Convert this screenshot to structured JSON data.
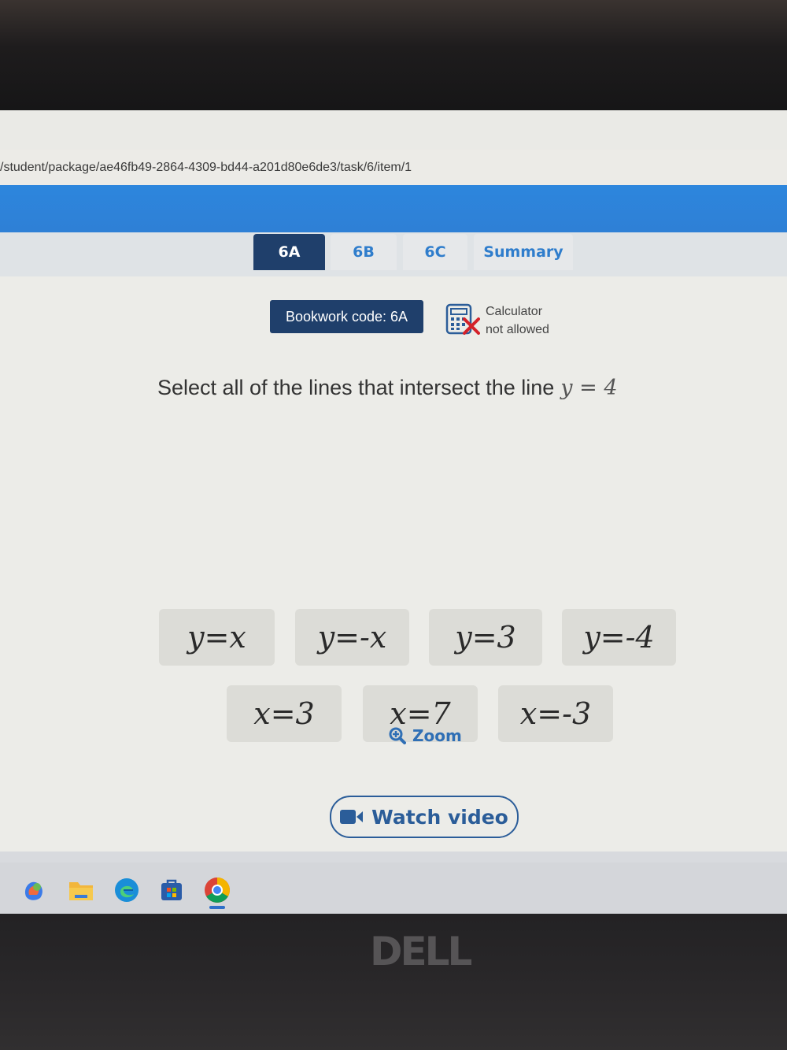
{
  "browser": {
    "url": "/student/package/ae46fb49-2864-4309-bd44-a201d80e6de3/task/6/item/1"
  },
  "tabs": [
    {
      "label": "6A",
      "active": true
    },
    {
      "label": "6B",
      "active": false
    },
    {
      "label": "6C",
      "active": false
    },
    {
      "label": "Summary",
      "active": false
    }
  ],
  "bookwork": {
    "label": "Bookwork code: 6A"
  },
  "calculator": {
    "line1": "Calculator",
    "line2": "not allowed",
    "icon": "calculator-not-allowed-icon"
  },
  "question": {
    "text": "Select all of the lines that intersect the line",
    "math": "y = 4"
  },
  "options_row1": [
    {
      "label": "y=x"
    },
    {
      "label": "y=-x"
    },
    {
      "label": "y=3"
    },
    {
      "label": "y=-4"
    }
  ],
  "options_row2": [
    {
      "label": "x=3"
    },
    {
      "label": "x=7"
    },
    {
      "label": "x=-3"
    }
  ],
  "zoom": {
    "label": "Zoom",
    "icon": "zoom-in-icon"
  },
  "video": {
    "label": "Watch video",
    "icon": "video-camera-icon"
  },
  "taskbar": {
    "icons": [
      "copilot-icon",
      "file-explorer-icon",
      "edge-icon",
      "store-icon",
      "chrome-icon"
    ]
  },
  "device": {
    "brand": "DELL"
  },
  "colors": {
    "navy": "#1f3f6b",
    "accent_blue": "#2f7dcc",
    "option_bg": "#dcdcd7"
  }
}
